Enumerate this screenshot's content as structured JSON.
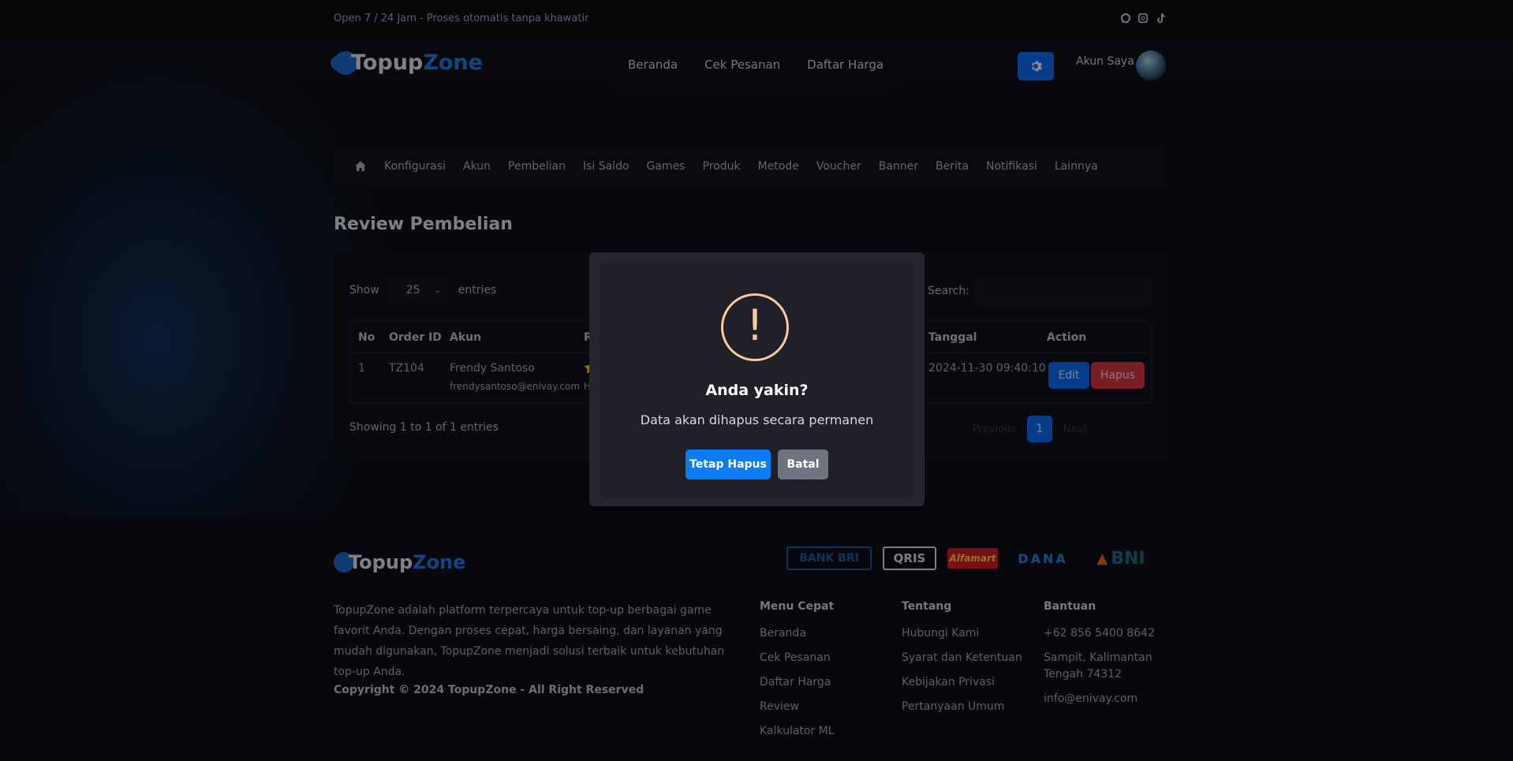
{
  "topbar": {
    "tagline": "Open 7 / 24 Jam - Proses otomatis tanpa khawatir"
  },
  "brand": {
    "part1": "Topup",
    "part2": "Zone"
  },
  "nav": {
    "items": [
      "Beranda",
      "Cek Pesanan",
      "Daftar Harga"
    ]
  },
  "account": {
    "label": "Akun Saya"
  },
  "admin_nav": {
    "items": [
      "Konfigurasi",
      "Akun",
      "Pembelian",
      "Isi Saldo",
      "Games",
      "Produk",
      "Metode",
      "Voucher",
      "Banner",
      "Berita",
      "Notifikasi",
      "Lainnya"
    ]
  },
  "page": {
    "title": "Review Pembelian"
  },
  "table_controls": {
    "show_label": "Show",
    "entries_value": "25",
    "entries_label": "entries",
    "search_label": "Search:"
  },
  "table": {
    "headers": {
      "no": "No",
      "order_id": "Order ID",
      "akun": "Akun",
      "review": "Rev",
      "tanggal": "Tanggal",
      "action": "Action"
    },
    "rows": [
      {
        "no": "1",
        "order_id": "TZ104",
        "name": "Frendy Santoso",
        "email": "frendysantoso@enivay.com",
        "review_star": "⭐",
        "review_text": "Har",
        "tanggal": "2024-11-30 09:40:10",
        "edit": "Edit",
        "delete": "Hapus"
      }
    ]
  },
  "pagination": {
    "info": "Showing 1 to 1 of 1 entries",
    "previous": "Previous",
    "page": "1",
    "next": "Next"
  },
  "modal": {
    "icon": "!",
    "title": "Anda yakin?",
    "text": "Data akan dihapus secara permanen",
    "confirm": "Tetap Hapus",
    "cancel": "Batal"
  },
  "footer": {
    "about": "TopupZone adalah platform terpercaya untuk top-up berbagai game favorit Anda. Dengan proses cepat, harga bersaing, dan layanan yang mudah digunakan, TopupZone menjadi solusi terbaik untuk kebutuhan top-up Anda.",
    "copyright": "Copyright © 2024 TopupZone - All Right Reserved",
    "payments": [
      "BANK BRI",
      "QRIS",
      "Alfamart",
      "DANA",
      "BNI"
    ],
    "menu_cepat": {
      "title": "Menu Cepat",
      "items": [
        "Beranda",
        "Cek Pesanan",
        "Daftar Harga",
        "Review",
        "Kalkulator ML"
      ]
    },
    "tentang": {
      "title": "Tentang",
      "items": [
        "Hubungi Kami",
        "Syarat dan Ketentuan",
        "Kebijakan Privasi",
        "Pertanyaan Umum"
      ]
    },
    "bantuan": {
      "title": "Bantuan",
      "items": [
        "+62 856 5400 8642",
        "Sampit, Kalimantan Tengah 74312",
        "info@enivay.com"
      ]
    }
  },
  "colors": {
    "primary": "#0d6efd",
    "danger": "#dc3545",
    "warning_icon": "#f8c8a0",
    "cancel": "#6e7580"
  }
}
